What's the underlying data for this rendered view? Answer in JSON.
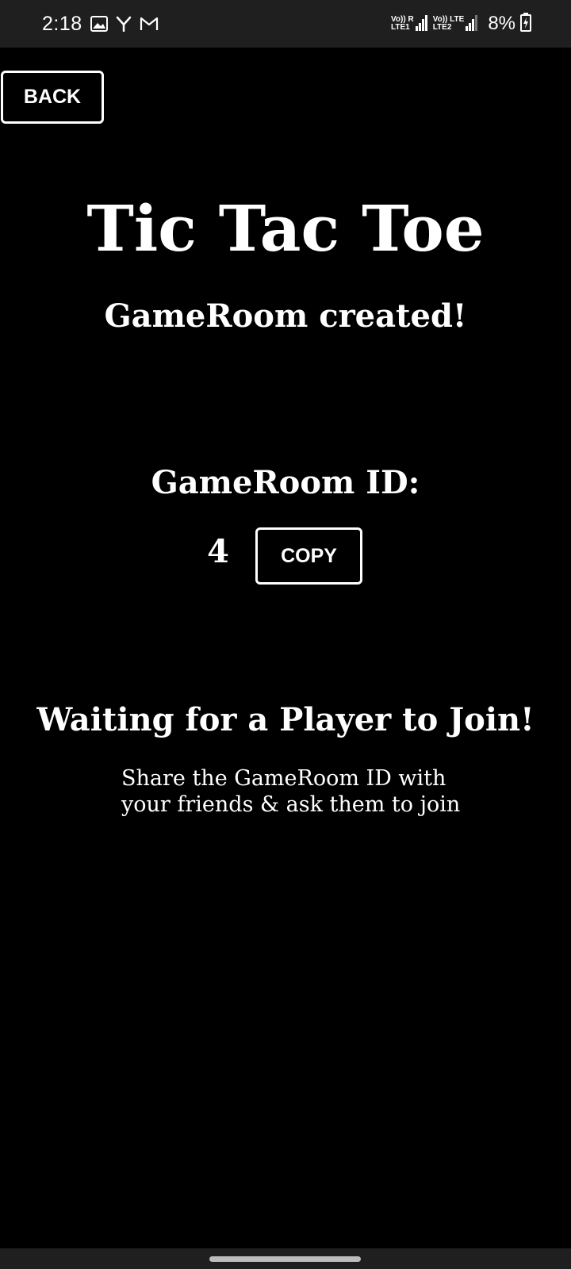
{
  "status_bar": {
    "time": "2:18",
    "left_icons": [
      "image-icon",
      "y-app-icon",
      "gmail-icon"
    ],
    "sim1": {
      "top": "Vo)) R",
      "bottom": "LTE1"
    },
    "sim2": {
      "top": "Vo)) LTE",
      "bottom": "LTE2"
    },
    "battery": "8%"
  },
  "back_button": {
    "label": "BACK"
  },
  "main": {
    "title": "Tic Tac Toe",
    "subtitle": "GameRoom created!",
    "room_label": "GameRoom ID:",
    "room_id": "4",
    "copy_label": "COPY",
    "waiting": "Waiting for a Player to Join!",
    "share_line1": "Share the GameRoom ID with",
    "share_line2": "your friends & ask them to join"
  },
  "colors": {
    "background": "#000000",
    "status_bar": "#1f1f1f",
    "text": "#ffffff"
  }
}
